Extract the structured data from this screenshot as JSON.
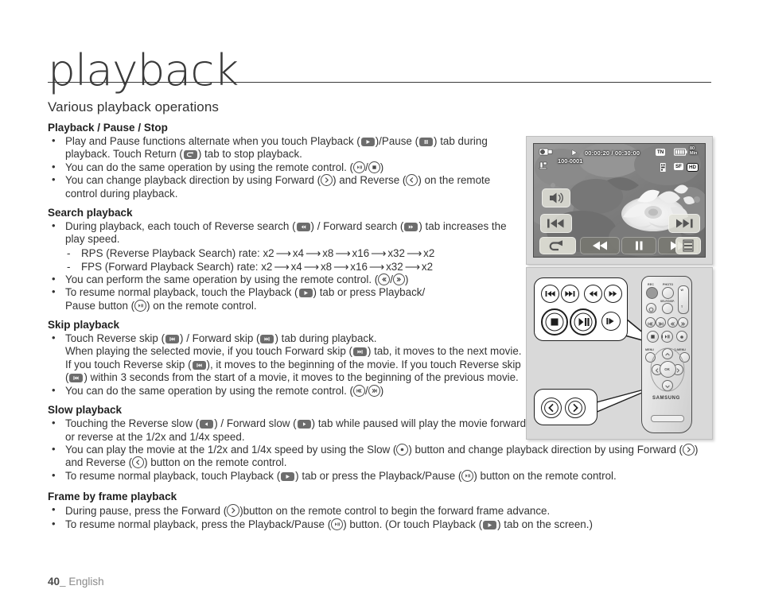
{
  "header": {
    "title": "playback"
  },
  "section": {
    "title": "Various playback operations"
  },
  "subsections": {
    "playback_pause_stop": "Playback / Pause / Stop",
    "search_playback": "Search playback",
    "skip_playback": "Skip playback",
    "slow_playback": "Slow playback",
    "frame_by_frame": "Frame by frame playback"
  },
  "body": {
    "pps_b1_a": "Play and Pause functions alternate when you touch Playback (",
    "pps_b1_b": ")/Pause (",
    "pps_b1_c": ") tab during playback. Touch Return (",
    "pps_b1_d": ") tab to stop playback.",
    "pps_b2_a": "You can do the same operation by using the remote control. (",
    "pps_b2_b": "/",
    "pps_b2_c": ")",
    "pps_b3_a": "You can change playback direction by using Forward (",
    "pps_b3_b": ") and Reverse (",
    "pps_b3_c": ") on the remote control during playback.",
    "sp_b1_a": "During playback, each touch of Reverse search (",
    "sp_b1_b": ") / Forward search (",
    "sp_b1_c": ") tab increases the play speed.",
    "sp_rps": "RPS (Reverse Playback Search) rate: x2",
    "sp_fps": "FPS (Forward Playback Search) rate: x2",
    "sp_rate_steps": [
      "x4",
      "x8",
      "x16",
      "x32",
      "x2"
    ],
    "sp_b2_a": "You can perform the same operation by using the remote control. (",
    "sp_b2_b": "/",
    "sp_b2_c": ")",
    "sp_b3_a": "To resume normal playback, touch the Playback (",
    "sp_b3_b": ") tab or press Playback/",
    "sp_b3_c": "Pause button (",
    "sp_b3_d": ") on the remote control.",
    "sk_b1_a": "Touch Reverse skip (",
    "sk_b1_b": ") / Forward skip (",
    "sk_b1_c": ") tab during playback.",
    "sk_b1_d": "When playing the selected movie, if you touch Forward skip (",
    "sk_b1_e": ") tab, it moves to the next movie.",
    "sk_b1_f": "If you touch Reverse skip (",
    "sk_b1_g": "), it moves to the beginning of the movie. If you touch Reverse skip (",
    "sk_b1_h": ") within 3 seconds from the start of a movie, it moves to the beginning of the previous movie.",
    "sk_b2_a": "You can do the same operation by using the remote control. (",
    "sk_b2_b": "/",
    "sk_b2_c": ")",
    "sl_b1_a": "Touching the Reverse slow (",
    "sl_b1_b": ") / Forward slow (",
    "sl_b1_c": ") tab while paused will play the movie forward or reverse at the 1/2x and 1/4x speed.",
    "sl_b2_a": "You can play the movie at the 1/2x and 1/4x speed by using the Slow (",
    "sl_b2_b": ") button and change playback direction by using Forward (",
    "sl_b2_c": ") and Reverse (",
    "sl_b2_d": ") button on the remote control.",
    "sl_b3_a": "To resume normal playback, touch Playback (",
    "sl_b3_b": ") tab or press the Playback/Pause (",
    "sl_b3_c": ") button on the remote control.",
    "ff_b1_a": "During pause, press the Forward (",
    "ff_b1_b": ")button on the remote control to begin the forward frame advance.",
    "ff_b2_a": "To resume normal playback, press the Playback/Pause (",
    "ff_b2_b": ") button. (Or touch Playback (",
    "ff_b2_c": ") tab on the screen.)"
  },
  "lcd": {
    "timecode": "00:00:20 / 00:30:00",
    "file_number": "100-0001",
    "battery_label_1": "80",
    "battery_label_2": "Min",
    "chip_sf": "SF",
    "chip_hd": "HD",
    "chip_tn": "TN"
  },
  "remote": {
    "label_rec": "REC",
    "label_photo": "PHOTO",
    "label_selfdisp": "SELF/DISP.",
    "label_menu": "MENU",
    "label_qmenu": "Q.MENU",
    "label_w": "W",
    "label_t": "T",
    "label_ok": "OK",
    "brand": "SAMSUNG"
  },
  "footer": {
    "page": "40",
    "underscore": "_",
    "language": "English"
  },
  "colors": {
    "text": "#333333",
    "tab_badge": "#6d6d6d",
    "rule": "#3a3a3a",
    "footer_page": "#4b4b4b",
    "footer_lang": "#8a8a8a"
  }
}
